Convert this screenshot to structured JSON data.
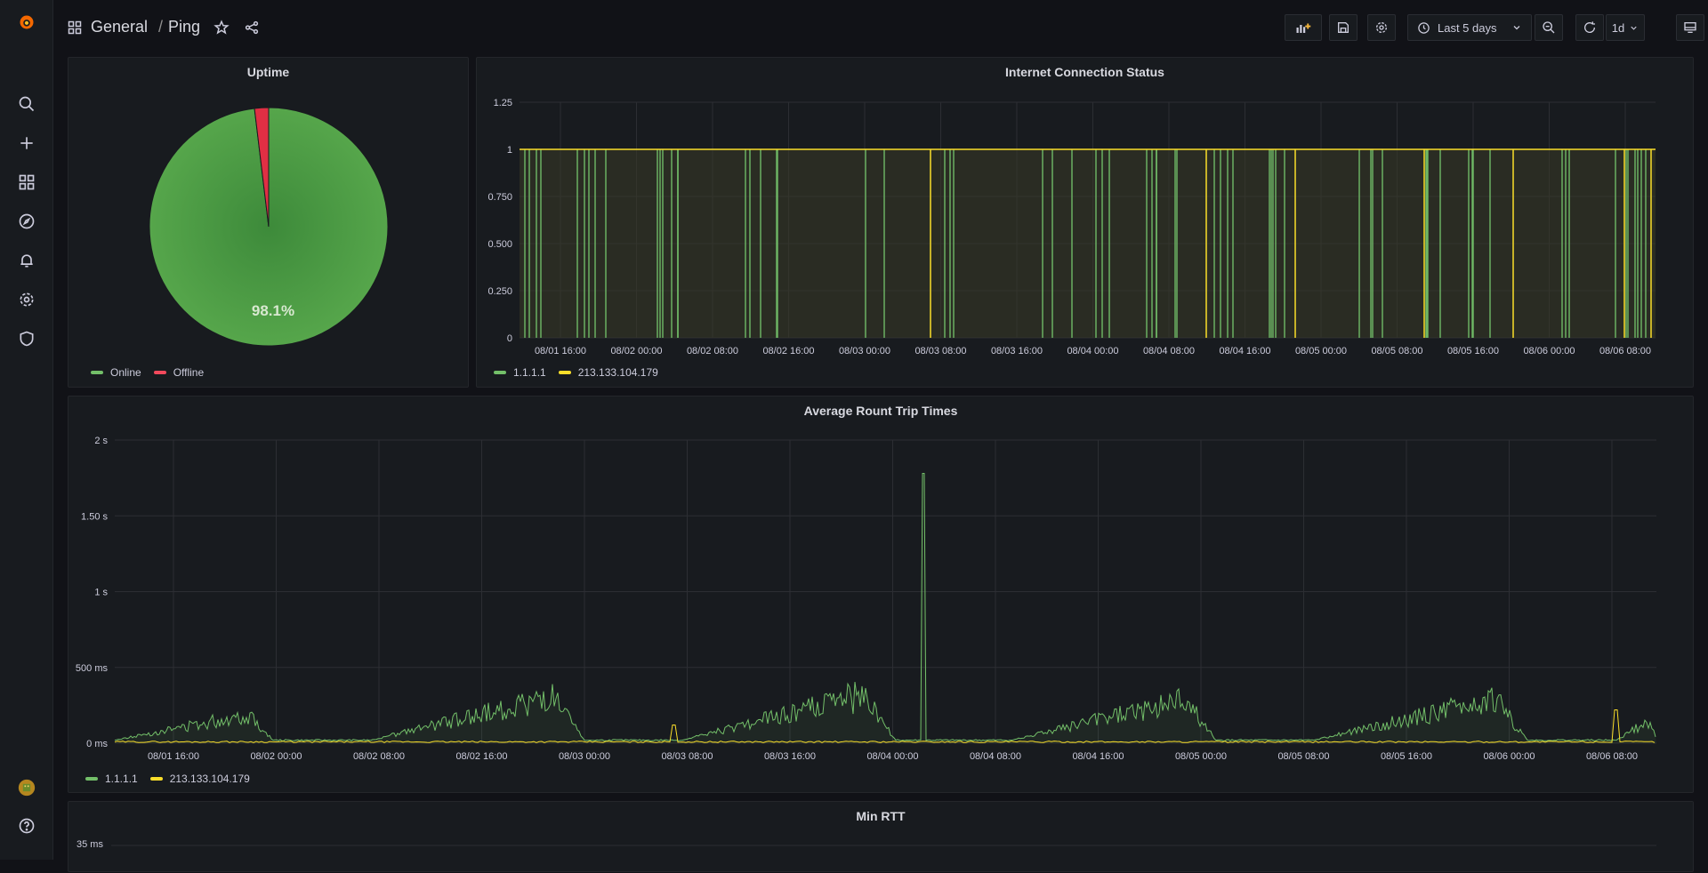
{
  "breadcrumb": {
    "folder": "General",
    "separator": "/",
    "dashboard": "Ping"
  },
  "toolbar": {
    "time_range": "Last 5 days",
    "refresh_interval": "1d"
  },
  "colors": {
    "online": "#56a64b",
    "offline": "#e02f44",
    "series1": "#73bf69",
    "series2": "#fade2a"
  },
  "uptime": {
    "title": "Uptime",
    "legend": [
      {
        "label": "Online",
        "color": "#73bf69"
      },
      {
        "label": "Offline",
        "color": "#f2495c"
      }
    ]
  },
  "status": {
    "title": "Internet Connection Status",
    "legend": [
      {
        "label": "1.1.1.1",
        "color": "#73bf69"
      },
      {
        "label": "213.133.104.179",
        "color": "#fade2a"
      }
    ]
  },
  "rtt": {
    "title": "Average Rount Trip Times",
    "legend": [
      {
        "label": "1.1.1.1",
        "color": "#73bf69"
      },
      {
        "label": "213.133.104.179",
        "color": "#fade2a"
      }
    ]
  },
  "minrtt": {
    "title": "Min RTT",
    "ylabel_top": "35 ms"
  },
  "chart_data": [
    {
      "type": "pie",
      "title": "Uptime",
      "labels": [
        "Online",
        "Offline"
      ],
      "values": [
        98.1,
        1.9
      ],
      "center_label": "98.1%"
    },
    {
      "type": "line",
      "title": "Internet Connection Status",
      "x_ticks": [
        "08/01 16:00",
        "08/02 00:00",
        "08/02 08:00",
        "08/02 16:00",
        "08/03 00:00",
        "08/03 08:00",
        "08/03 16:00",
        "08/04 00:00",
        "08/04 08:00",
        "08/04 16:00",
        "08/05 00:00",
        "08/05 08:00",
        "08/05 16:00",
        "08/06 00:00",
        "08/06 08:00"
      ],
      "y_ticks": [
        "0",
        "0.250",
        "0.500",
        "0.750",
        "1",
        "1.25"
      ],
      "ylim": [
        0,
        1.25
      ],
      "series": [
        {
          "name": "1.1.1.1",
          "baseline": 1,
          "drops_to": 0
        },
        {
          "name": "213.133.104.179",
          "baseline": 1,
          "drops_to": 0
        }
      ]
    },
    {
      "type": "area",
      "title": "Average Rount Trip Times",
      "x_ticks": [
        "08/01 16:00",
        "08/02 00:00",
        "08/02 08:00",
        "08/02 16:00",
        "08/03 00:00",
        "08/03 08:00",
        "08/03 16:00",
        "08/04 00:00",
        "08/04 08:00",
        "08/04 16:00",
        "08/05 00:00",
        "08/05 08:00",
        "08/05 16:00",
        "08/06 00:00",
        "08/06 08:00"
      ],
      "y_ticks": [
        "0 ms",
        "500 ms",
        "1 s",
        "1.50 s",
        "2 s"
      ],
      "ylim_ms": [
        0,
        2000
      ],
      "series": [
        {
          "name": "1.1.1.1",
          "typical_ms": [
            20,
            400
          ],
          "peak_ms": 1780
        },
        {
          "name": "213.133.104.179",
          "typical_ms": [
            0,
            20
          ],
          "peak_ms": 220
        }
      ]
    }
  ]
}
